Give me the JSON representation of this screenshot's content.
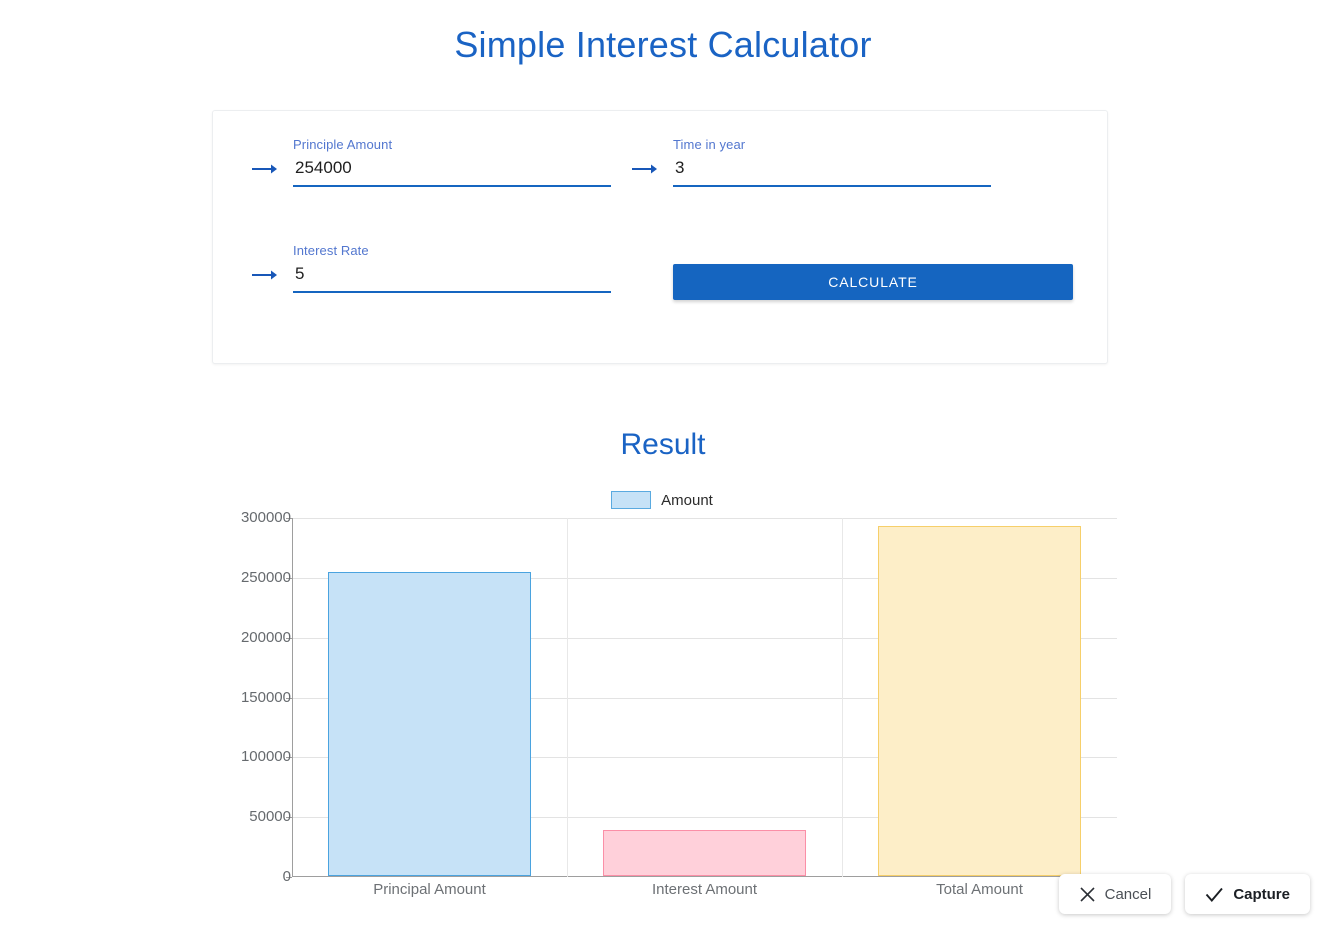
{
  "app": {
    "title": "Simple Interest Calculator",
    "result_heading": "Result"
  },
  "form": {
    "fields": [
      {
        "label": "Principle Amount",
        "value": "254000",
        "placeholder": "",
        "icon": "arrow-right-icon"
      },
      {
        "label": "Time in year",
        "value": "3",
        "placeholder": "",
        "icon": "arrow-right-icon"
      },
      {
        "label": "Interest Rate",
        "value": "5",
        "placeholder": "",
        "icon": "arrow-right-icon"
      }
    ],
    "calculate_label": "CALCULATE",
    "accent_color": "#1565C0",
    "label_color": "#5377cf"
  },
  "chart_data": {
    "type": "bar",
    "title": "Result",
    "categories": [
      "Principal Amount",
      "Interest Amount",
      "Total Amount"
    ],
    "values": [
      254000,
      38100,
      292100
    ],
    "series": [
      {
        "name": "Amount",
        "values": [
          254000,
          38100,
          292100
        ]
      }
    ],
    "legend": {
      "entries": [
        "Amount"
      ],
      "position": "top-center"
    },
    "xlabel": "",
    "ylabel": "",
    "ylim": [
      0,
      300000
    ],
    "yticks": [
      0,
      50000,
      100000,
      150000,
      200000,
      250000,
      300000
    ],
    "ytick_labels": [
      "0",
      "50000",
      "100000",
      "150000",
      "200000",
      "250000",
      "300000"
    ],
    "grid": true,
    "bar_colors": [
      "#c6e2f7",
      "#ffd0da",
      "#fdeec8"
    ],
    "bar_border_colors": [
      "#4aa3df",
      "#fb8fa7",
      "#f6cf6a"
    ]
  },
  "capture_bar": {
    "cancel_label": "Cancel",
    "capture_label": "Capture"
  }
}
